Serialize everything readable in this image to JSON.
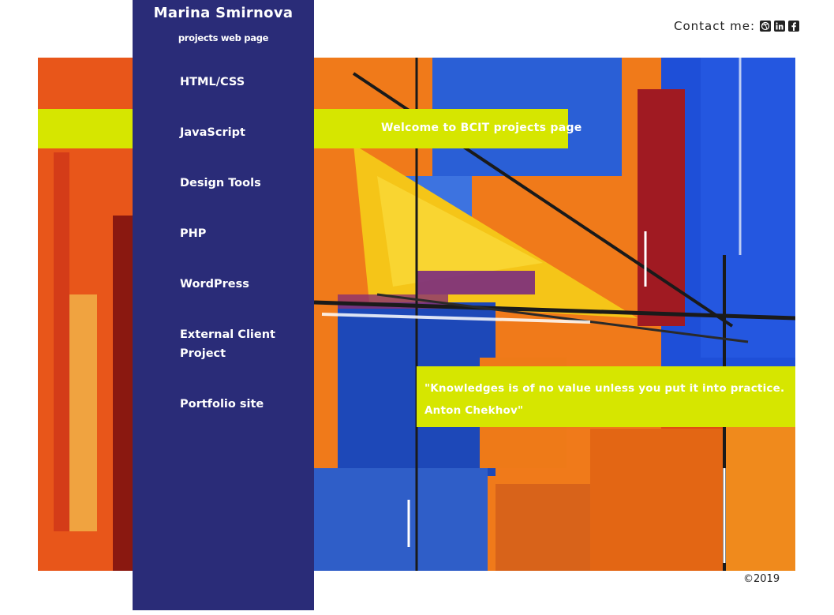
{
  "header": {
    "contact_label": "Contact me:",
    "social": [
      {
        "name": "dribbble-icon",
        "glyph": "dribbble"
      },
      {
        "name": "linkedin-icon",
        "glyph": "in"
      },
      {
        "name": "facebook-icon",
        "glyph": "f"
      }
    ]
  },
  "sidebar": {
    "brand_name": "Marina Smirnova",
    "brand_subtitle": "projects web page",
    "items": [
      {
        "label": "HTML/CSS"
      },
      {
        "label": "JavaScript"
      },
      {
        "label": "Design Tools"
      },
      {
        "label": "PHP"
      },
      {
        "label": "WordPress"
      },
      {
        "label": "External Client\nProject"
      },
      {
        "label": "Portfolio site"
      }
    ]
  },
  "hero": {
    "welcome": "Welcome to BCIT projects page",
    "quote_line1": "\"Knowledges is of no value unless you put it into practice.",
    "quote_line2": "Anton Chekhov\""
  },
  "footer": {
    "copyright": "©2019"
  },
  "colors": {
    "sidebar": "#2a2c78",
    "accent": "#d6e600"
  }
}
